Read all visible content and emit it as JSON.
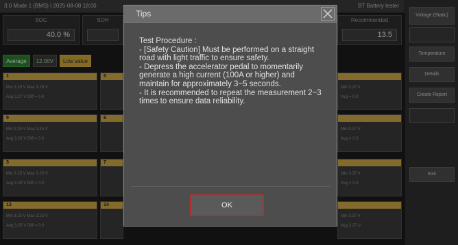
{
  "status_bar": {
    "left_text": "3.0 Mode 1 (BMS) | 2025-08-08 18:00",
    "right_text": "BT Battery tester"
  },
  "summary": [
    {
      "label": "SOC",
      "value": "40.0 %"
    },
    {
      "label": "SOH",
      "value": ""
    },
    {
      "label": "Recommended",
      "value": "13.5"
    }
  ],
  "filters": {
    "green_chip": "Average",
    "dark_chip": "12.00V",
    "yellow_chip": "Low value"
  },
  "cells": [
    {
      "id": "1",
      "r1": "Min  3.25 V   Max  3.28 V",
      "r2": "Avg  3.27 V   Diff  = 0.0"
    },
    {
      "id": "5",
      "r1": "Min  3.25 V",
      "r2": "Avg  3.27 V"
    },
    {
      "id": "",
      "r1": "Min  3.27 V",
      "r2": "Avg = 0.0"
    },
    {
      "id": "9",
      "r1": "Min  3.26 V   Max  3.25 V",
      "r2": "Avg  3.26 V   Diff  = 0.0"
    },
    {
      "id": "6",
      "r1": "Min  3.25 V",
      "r2": "Avg  3.25 V"
    },
    {
      "id": "",
      "r1": "Min  3.27 V",
      "r2": "Avg = 0.0"
    },
    {
      "id": "3",
      "r1": "Min  3.25 V   Max  3.25 V",
      "r2": "Avg  3.25 V   Diff  = 0.0"
    },
    {
      "id": "7",
      "r1": "Min  3.25 V",
      "r2": "Avg  3.25 V"
    },
    {
      "id": "",
      "r1": "Min  3.27 V",
      "r2": "Avg = 0.0"
    },
    {
      "id": "13",
      "r1": "Min  3.25 V   Max  3.25 V",
      "r2": "Avg  3.25 V   Diff  = 0.0"
    },
    {
      "id": "14",
      "r1": "Min  3.25 V",
      "r2": "Avg  3.25 V"
    },
    {
      "id": "",
      "r1": "Min  3.27 V",
      "r2": "Avg 3.27 V"
    }
  ],
  "sidebar": {
    "buttons": [
      {
        "label": "Voltage (Static)"
      },
      {
        "label": ""
      },
      {
        "label": "Temperature"
      },
      {
        "label": "Details"
      },
      {
        "label": "Create Report"
      },
      {
        "label": ""
      },
      {
        "label": "Exit"
      }
    ]
  },
  "dialog": {
    "title": "Tips",
    "body": [
      "Test Procedure :",
      "- [Safety Caution] Must be performed on a straight road with light traffic to ensure safety.",
      "- Depress the accelerator pedal to momentarily generate a high current (100A or higher) and maintain for approximately 3~5 seconds.",
      "- It is recommended to repeat the measurement 2~3 times to ensure data reliability."
    ],
    "ok_label": "OK"
  }
}
